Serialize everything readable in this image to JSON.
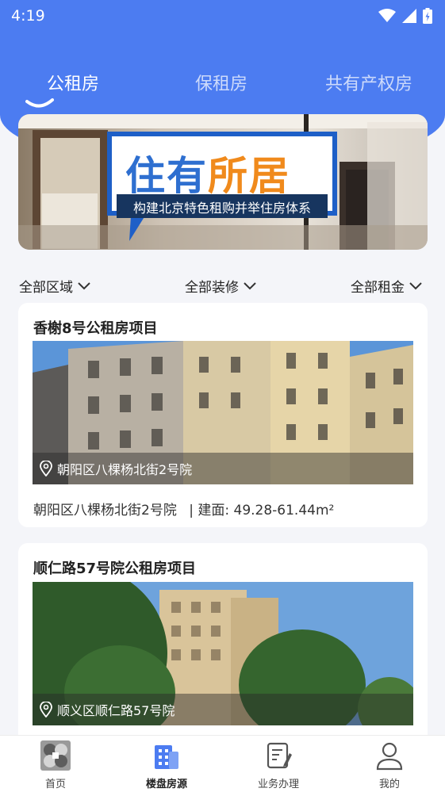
{
  "status_bar": {
    "time": "4:19"
  },
  "tabs": [
    {
      "label": "公租房",
      "active": true
    },
    {
      "label": "保租房",
      "active": false
    },
    {
      "label": "共有产权房",
      "active": false
    }
  ],
  "banner": {
    "headline_part1": "住有",
    "headline_part2": "所居",
    "subtitle": "构建北京特色租购并举住房体系"
  },
  "filters": [
    {
      "label": "全部区域"
    },
    {
      "label": "全部装修"
    },
    {
      "label": "全部租金"
    }
  ],
  "listings": [
    {
      "title": "香榭8号公租房项目",
      "location": "朝阳区八棵杨北街2号院",
      "address": "朝阳区八棵杨北街2号院",
      "area": "| 建面: 49.28-61.44m²"
    },
    {
      "title": "顺仁路57号院公租房项目",
      "location": "顺义区顺仁路57号院"
    }
  ],
  "bottom_nav": [
    {
      "label": "首页",
      "icon": "home-logo-icon",
      "active": false
    },
    {
      "label": "楼盘房源",
      "icon": "building-icon",
      "active": true
    },
    {
      "label": "业务办理",
      "icon": "document-edit-icon",
      "active": false
    },
    {
      "label": "我的",
      "icon": "user-icon",
      "active": false
    }
  ],
  "colors": {
    "primary": "#4c7cf1",
    "banner_orange": "#f08a1c",
    "banner_blue": "#2e6fd0"
  }
}
